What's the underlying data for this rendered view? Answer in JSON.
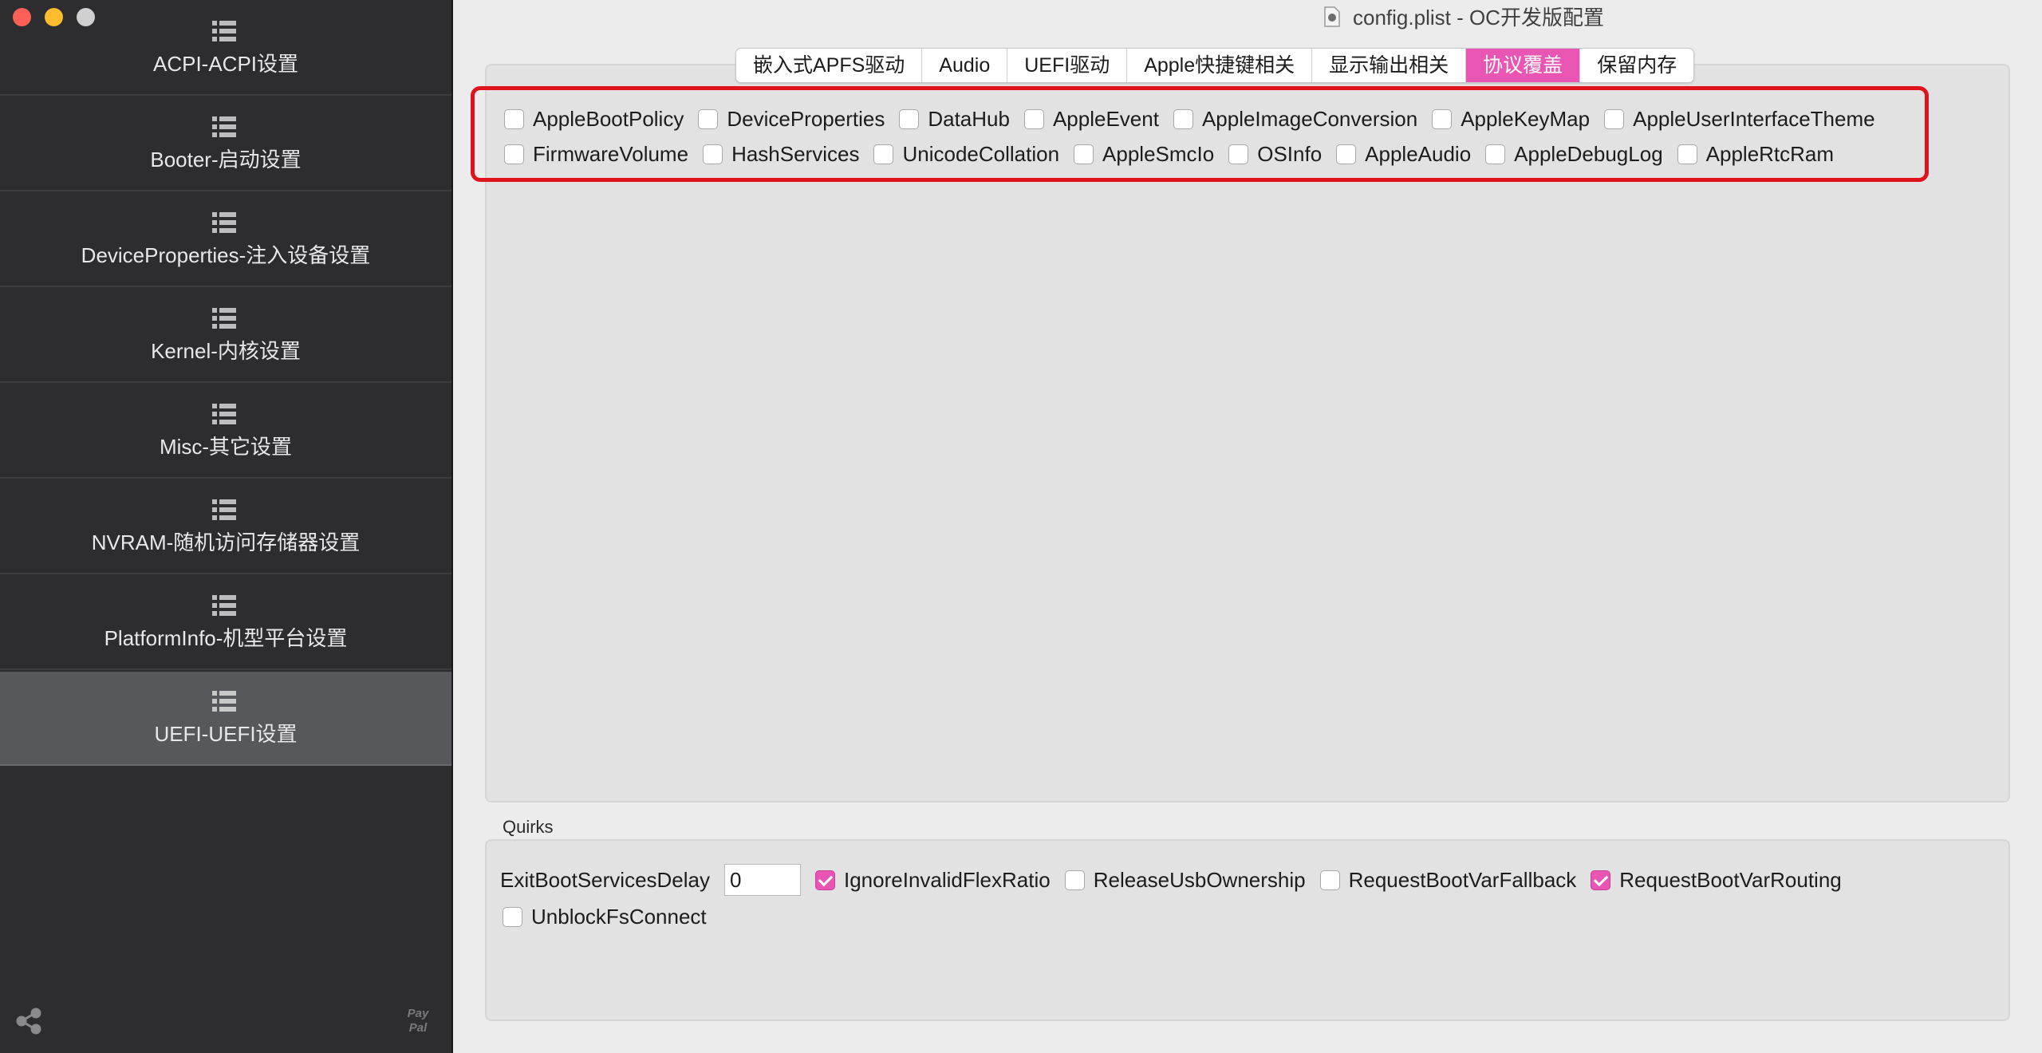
{
  "window": {
    "title": "config.plist - OC开发版配置",
    "controls": [
      "close",
      "minimize",
      "zoom"
    ]
  },
  "sidebar": {
    "items": [
      {
        "label": "ACPI-ACPI设置",
        "icon": "list-icon",
        "selected": false
      },
      {
        "label": "Booter-启动设置",
        "icon": "list-icon",
        "selected": false
      },
      {
        "label": "DeviceProperties-注入设备设置",
        "icon": "list-icon",
        "selected": false
      },
      {
        "label": "Kernel-内核设置",
        "icon": "list-icon",
        "selected": false
      },
      {
        "label": "Misc-其它设置",
        "icon": "list-icon",
        "selected": false
      },
      {
        "label": "NVRAM-随机访问存储器设置",
        "icon": "list-icon",
        "selected": false
      },
      {
        "label": "PlatformInfo-机型平台设置",
        "icon": "list-icon",
        "selected": false
      },
      {
        "label": "UEFI-UEFI设置",
        "icon": "list-icon",
        "selected": true
      }
    ],
    "footer_icons": [
      "share-icon",
      "paypal-icon"
    ],
    "paypal_text": [
      "Pay",
      "Pal"
    ]
  },
  "tabs": [
    {
      "label": "嵌入式APFS驱动",
      "active": false
    },
    {
      "label": "Audio",
      "active": false
    },
    {
      "label": "UEFI驱动",
      "active": false
    },
    {
      "label": "Apple快捷键相关",
      "active": false
    },
    {
      "label": "显示输出相关",
      "active": false
    },
    {
      "label": "协议覆盖",
      "active": true
    },
    {
      "label": "保留内存",
      "active": false
    }
  ],
  "protocols": {
    "row1": [
      {
        "label": "AppleBootPolicy",
        "checked": false
      },
      {
        "label": "DeviceProperties",
        "checked": false
      },
      {
        "label": "DataHub",
        "checked": false
      },
      {
        "label": "AppleEvent",
        "checked": false
      },
      {
        "label": "AppleImageConversion",
        "checked": false
      },
      {
        "label": "AppleKeyMap",
        "checked": false
      },
      {
        "label": "AppleUserInterfaceTheme",
        "checked": false
      }
    ],
    "row2": [
      {
        "label": "FirmwareVolume",
        "checked": false
      },
      {
        "label": "HashServices",
        "checked": false
      },
      {
        "label": "UnicodeCollation",
        "checked": false
      },
      {
        "label": "AppleSmcIo",
        "checked": false
      },
      {
        "label": "OSInfo",
        "checked": false
      },
      {
        "label": "AppleAudio",
        "checked": false
      },
      {
        "label": "AppleDebugLog",
        "checked": false
      },
      {
        "label": "AppleRtcRam",
        "checked": false
      }
    ]
  },
  "quirks": {
    "title": "Quirks",
    "exit_boot_services_delay_label": "ExitBootServicesDelay",
    "exit_boot_services_delay_value": "0",
    "row1": [
      {
        "label": "IgnoreInvalidFlexRatio",
        "checked": true
      },
      {
        "label": "ReleaseUsbOwnership",
        "checked": false
      },
      {
        "label": "RequestBootVarFallback",
        "checked": false
      },
      {
        "label": "RequestBootVarRouting",
        "checked": true
      }
    ],
    "row2": [
      {
        "label": "UnblockFsConnect",
        "checked": false
      }
    ]
  },
  "colors": {
    "accent": "#e955b2",
    "sidebar_bg": "#2d2d30",
    "sidebar_selected": "#57585b",
    "highlight_border": "#e0121b",
    "content_bg": "#ececec"
  }
}
